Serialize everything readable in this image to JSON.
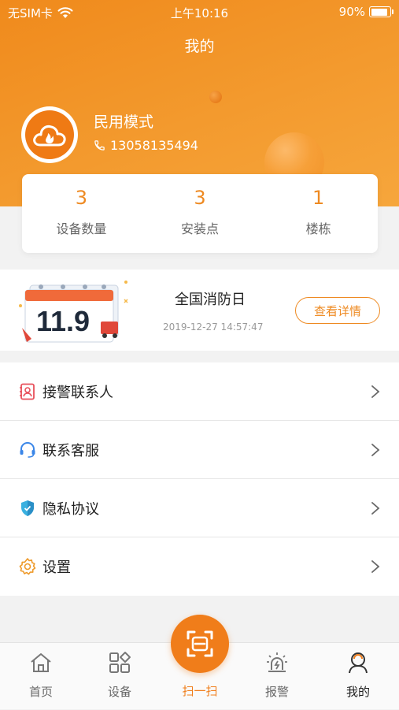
{
  "status_bar": {
    "carrier": "无SIM卡",
    "time": "上午10:16",
    "battery": "90%"
  },
  "header": {
    "title": "我的"
  },
  "user": {
    "mode": "民用模式",
    "phone": "13058135494"
  },
  "stats": [
    {
      "value": "3",
      "label": "设备数量"
    },
    {
      "value": "3",
      "label": "安装点"
    },
    {
      "value": "1",
      "label": "楼栋"
    }
  ],
  "banner": {
    "art_text": "11.9",
    "title": "全国消防日",
    "time": "2019-12-27 14:57:47",
    "button": "查看详情"
  },
  "menu": [
    {
      "label": "接警联系人",
      "icon": "contact-book-icon"
    },
    {
      "label": "联系客服",
      "icon": "headset-icon"
    },
    {
      "label": "隐私协议",
      "icon": "shield-icon"
    },
    {
      "label": "设置",
      "icon": "gear-icon"
    }
  ],
  "tabbar": {
    "items": [
      {
        "label": "首页",
        "icon": "home-icon"
      },
      {
        "label": "设备",
        "icon": "devices-icon"
      },
      {
        "label": "扫一扫",
        "icon": "scan-icon"
      },
      {
        "label": "报警",
        "icon": "alarm-icon"
      },
      {
        "label": "我的",
        "icon": "user-icon"
      }
    ],
    "active": "我的"
  },
  "colors": {
    "accent": "#f07d1a",
    "header_start": "#f08a1c",
    "header_end": "#f6a63c",
    "stat_value": "#ee8a22"
  }
}
